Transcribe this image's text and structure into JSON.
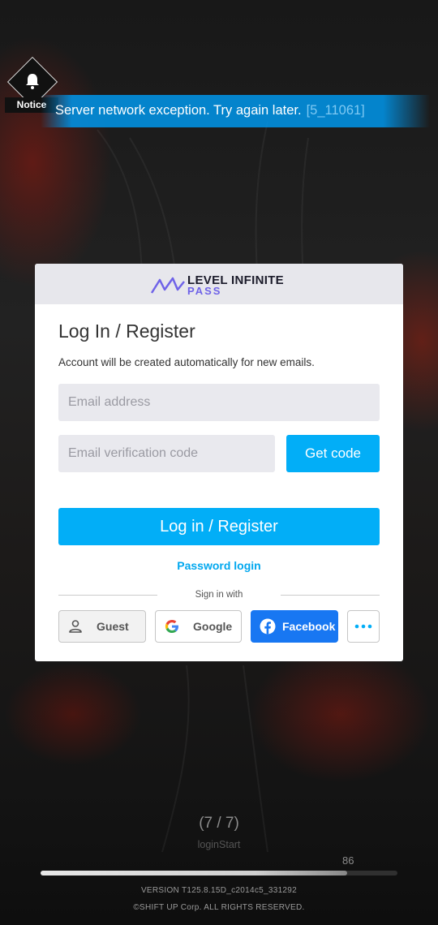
{
  "notice": {
    "label": "Notice",
    "icon": "bell-icon",
    "message": "Server network exception. Try again later.",
    "code": "[5_11061]"
  },
  "login_panel": {
    "logo": {
      "line1": "LEVEL INFINITE",
      "line2": "PASS"
    },
    "title": "Log In / Register",
    "subtitle": "Account will be created automatically for new emails.",
    "email_placeholder": "Email address",
    "code_placeholder": "Email verification code",
    "get_code_label": "Get code",
    "submit_label": "Log in / Register",
    "password_login_label": "Password login",
    "sign_in_with_label": "Sign in with",
    "social": {
      "guest_label": "Guest",
      "google_label": "Google",
      "facebook_label": "Facebook",
      "more_icon": "more-icon"
    },
    "colors": {
      "accent": "#02aef7",
      "facebook": "#1877f2"
    }
  },
  "loader": {
    "count": "(7 / 7)",
    "step": "loginStart",
    "percent": "86",
    "progress_fraction": 0.86
  },
  "footer": {
    "version": "VERSION   T125.8.15D_c2014c5_331292",
    "copyright": "©SHIFT UP Corp. ALL RIGHTS  RESERVED."
  }
}
